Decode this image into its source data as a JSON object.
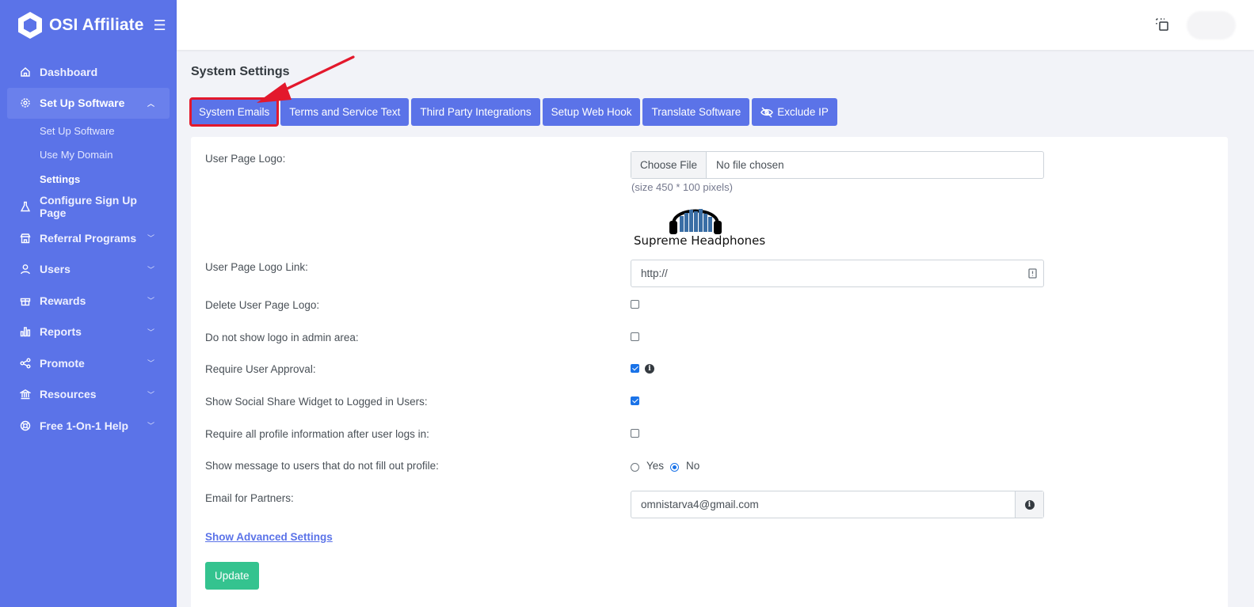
{
  "brand": {
    "name": "OSI Affiliate"
  },
  "sidebar": {
    "items": [
      {
        "label": "Dashboard",
        "icon": "home-icon",
        "expandable": false
      },
      {
        "label": "Set Up Software",
        "icon": "gear-icon",
        "expandable": true,
        "expanded": true,
        "children": [
          {
            "label": "Set Up Software"
          },
          {
            "label": "Use My Domain"
          },
          {
            "label": "Settings",
            "current": true
          }
        ]
      },
      {
        "label": "Configure Sign Up Page",
        "icon": "flask-icon",
        "expandable": false
      },
      {
        "label": "Referral Programs",
        "icon": "store-icon",
        "expandable": true
      },
      {
        "label": "Users",
        "icon": "user-icon",
        "expandable": true
      },
      {
        "label": "Rewards",
        "icon": "gift-icon",
        "expandable": true
      },
      {
        "label": "Reports",
        "icon": "bar-chart-icon",
        "expandable": true
      },
      {
        "label": "Promote",
        "icon": "share-icon",
        "expandable": true
      },
      {
        "label": "Resources",
        "icon": "bank-icon",
        "expandable": true
      },
      {
        "label": "Free 1-On-1 Help",
        "icon": "lifebuoy-icon",
        "expandable": true
      }
    ]
  },
  "page": {
    "title": "System Settings"
  },
  "tabs": [
    {
      "label": "System Emails",
      "active": true
    },
    {
      "label": "Terms and Service Text"
    },
    {
      "label": "Third Party Integrations"
    },
    {
      "label": "Setup Web Hook"
    },
    {
      "label": "Translate Software"
    },
    {
      "label": "Exclude IP",
      "icon": "eye-slash-icon"
    }
  ],
  "form": {
    "logo": {
      "label": "User Page Logo:",
      "choose_label": "Choose File",
      "file_status": "No file chosen",
      "hint": "(size 450 * 100 pixels)",
      "preview_text": "Supreme Headphones"
    },
    "logo_link": {
      "label": "User Page Logo Link:",
      "value": "http://"
    },
    "delete_logo": {
      "label": "Delete User Page Logo:",
      "checked": false
    },
    "hide_logo_admin": {
      "label": "Do not show logo in admin area:",
      "checked": false
    },
    "require_approval": {
      "label": "Require User Approval:",
      "checked": true
    },
    "social_widget": {
      "label": "Show Social Share Widget to Logged in Users:",
      "checked": true
    },
    "require_profile": {
      "label": "Require all profile information after user logs in:",
      "checked": false
    },
    "profile_message": {
      "label": "Show message to users that do not fill out profile:",
      "yes_label": "Yes",
      "no_label": "No",
      "selected": "No"
    },
    "partner_email": {
      "label": "Email for Partners:",
      "value": "omnistarva4@gmail.com"
    },
    "advanced_link": "Show Advanced Settings",
    "update_label": "Update"
  },
  "colors": {
    "sidebar": "#5b73e8",
    "tab": "#5b73e8",
    "update": "#34c38f",
    "annotation": "#e3182c"
  }
}
